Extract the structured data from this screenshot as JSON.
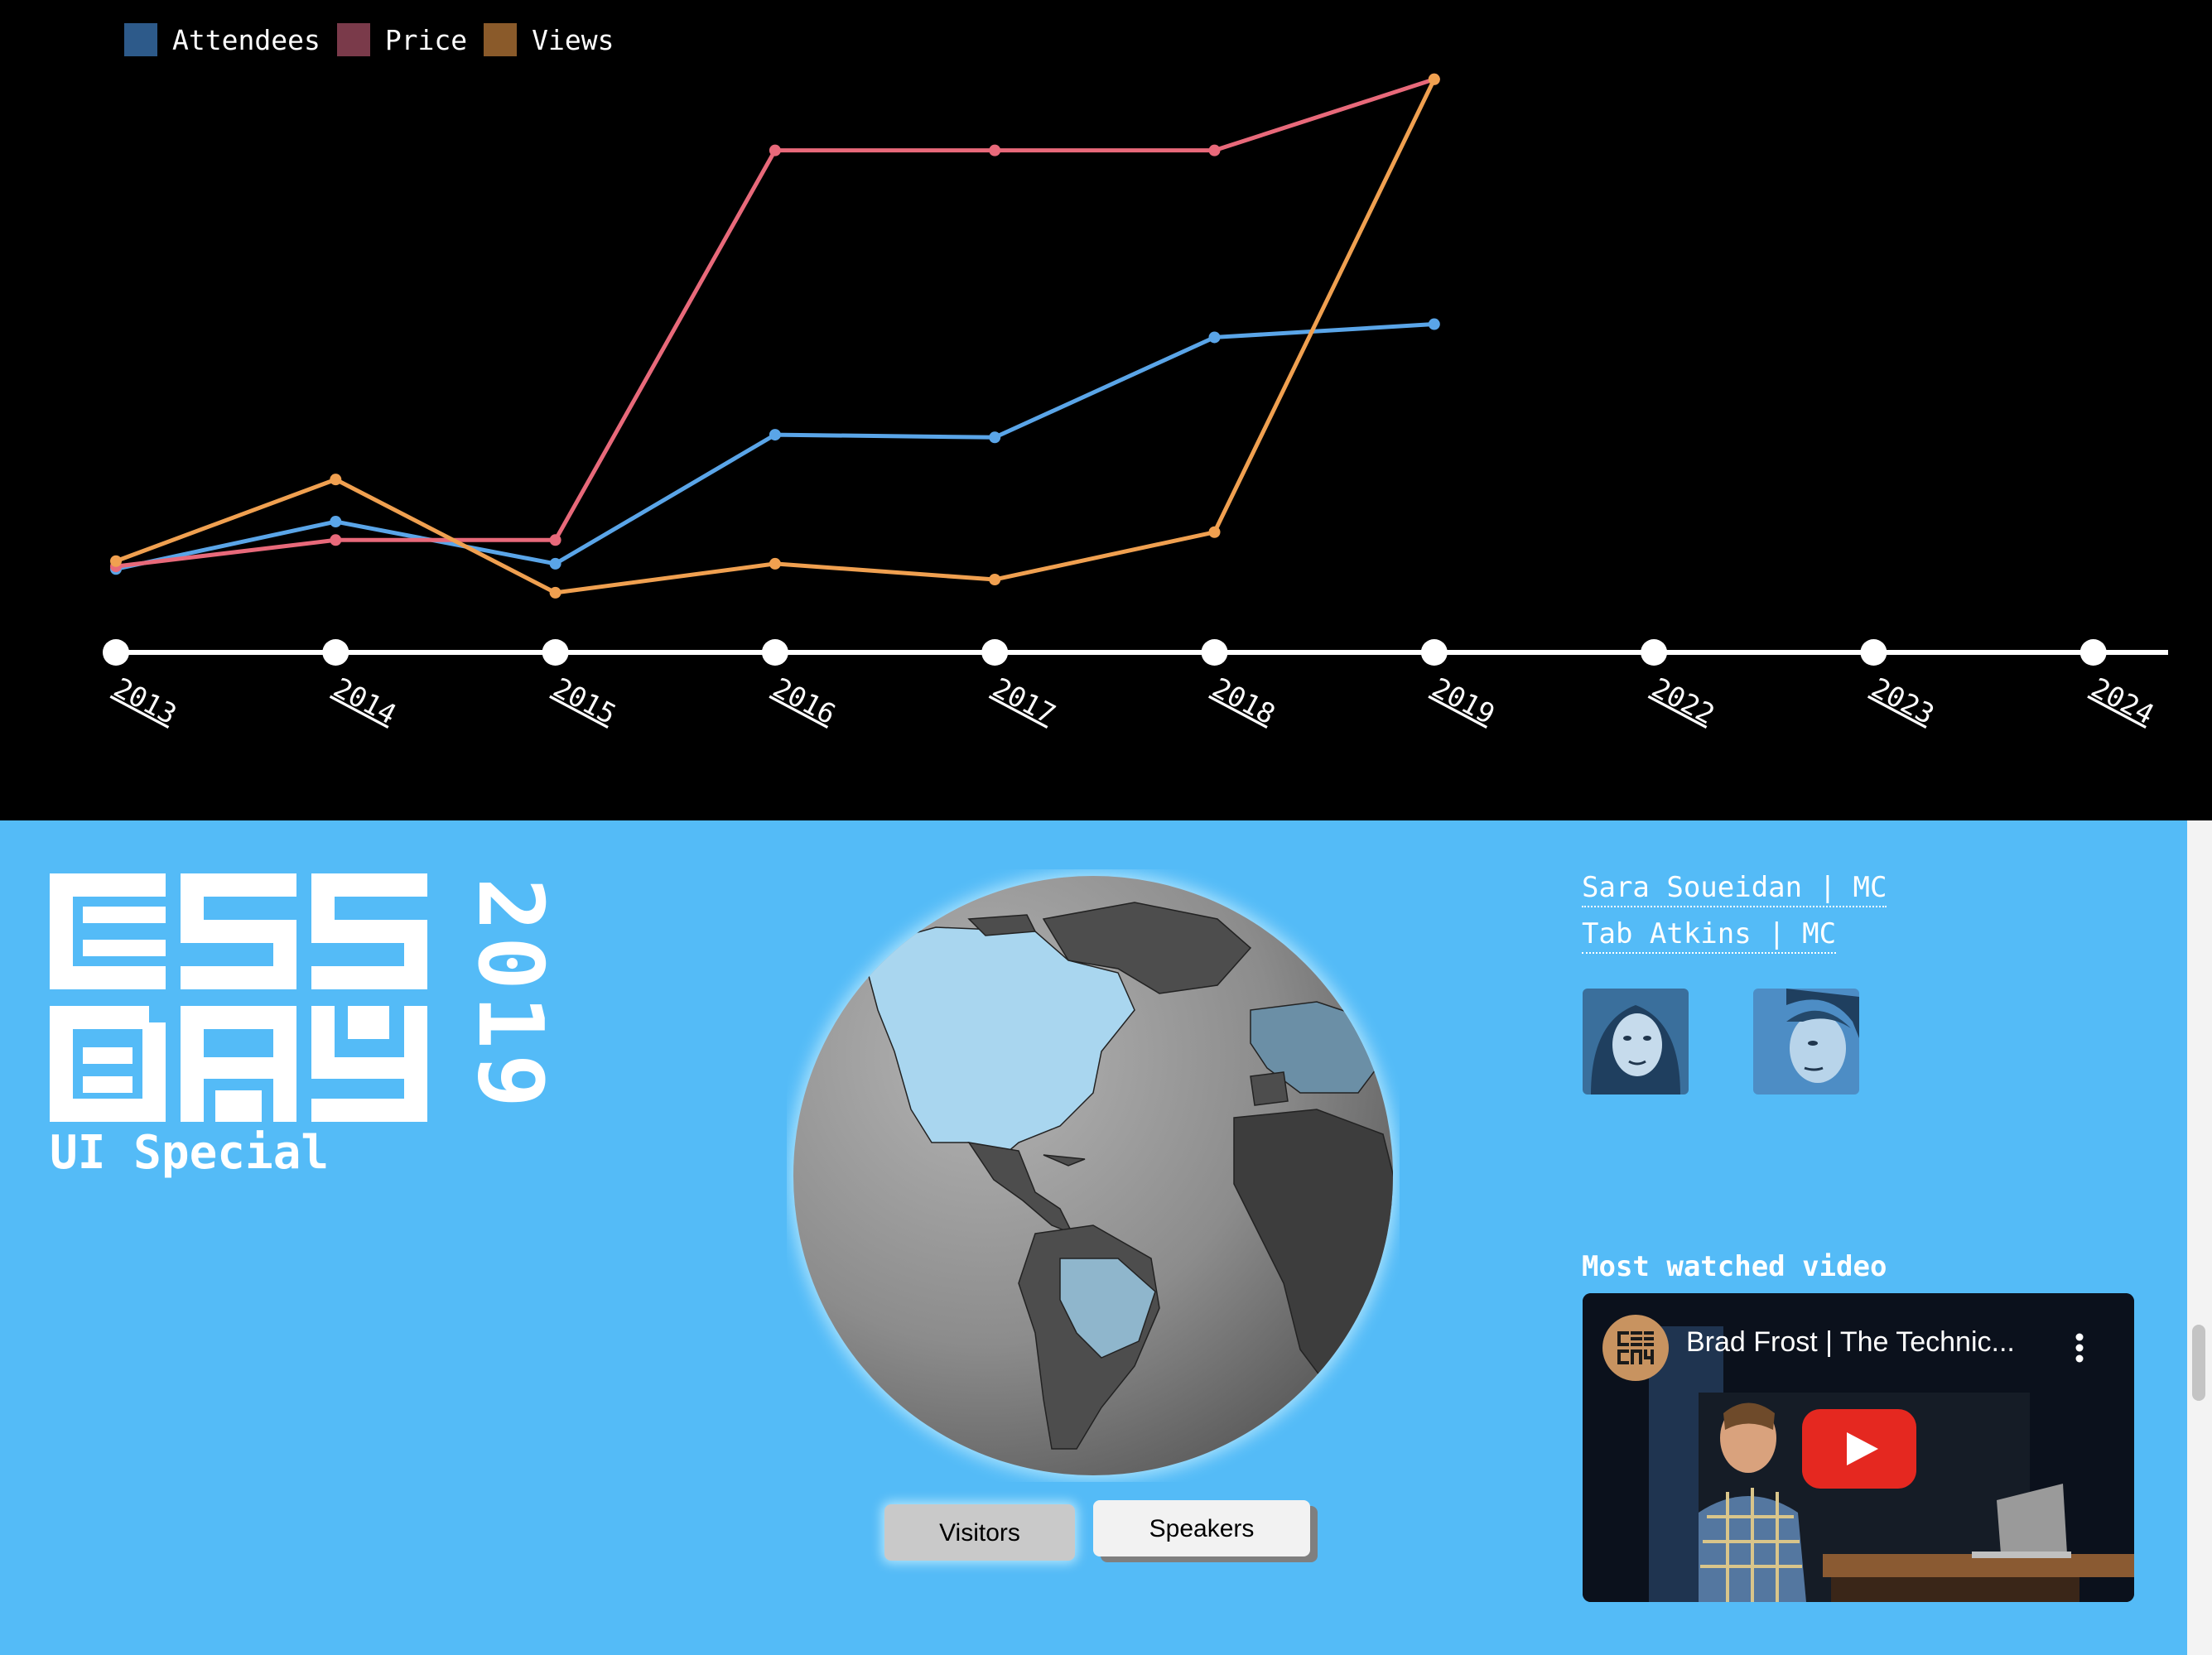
{
  "legend": [
    {
      "label": "Attendees",
      "color": "#2d5a8a"
    },
    {
      "label": "Price",
      "color": "#7a3a4a"
    },
    {
      "label": "Views",
      "color": "#8a5a2a"
    }
  ],
  "chart_data": {
    "type": "line",
    "x": [
      "2013",
      "2014",
      "2015",
      "2016",
      "2017",
      "2018",
      "2019",
      "2022",
      "2023",
      "2024"
    ],
    "series": [
      {
        "name": "Attendees",
        "color": "#5aa5e8",
        "values": [
          0.04,
          0.22,
          0.06,
          0.55,
          0.54,
          0.92,
          0.97,
          null,
          null,
          null
        ]
      },
      {
        "name": "Price",
        "color": "#e8697a",
        "values": [
          0.05,
          0.15,
          0.15,
          1.63,
          1.63,
          1.63,
          1.9,
          null,
          null,
          null
        ]
      },
      {
        "name": "Views",
        "color": "#f0a050",
        "values": [
          0.07,
          0.38,
          -0.05,
          0.06,
          0.0,
          0.18,
          1.9,
          null,
          null,
          null
        ]
      }
    ],
    "grid": false
  },
  "logo": {
    "year": "2019",
    "subtitle": "UI Special"
  },
  "toggle": {
    "visitors": "Visitors",
    "speakers": "Speakers",
    "active": "Speakers"
  },
  "mcs": [
    {
      "label": "Sara Soueidan | MC"
    },
    {
      "label": "Tab Atkins | MC"
    }
  ],
  "video": {
    "heading": "Most watched video",
    "title": "Brad Frost | The Technic..."
  }
}
